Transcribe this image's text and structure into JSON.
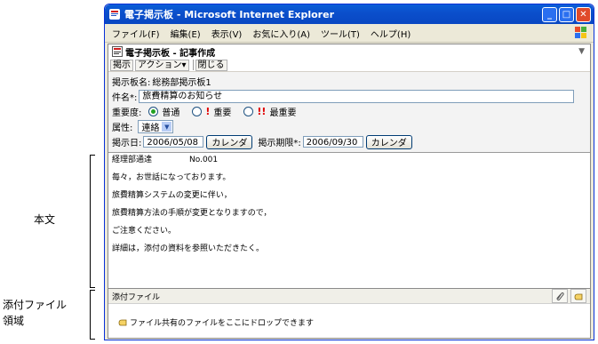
{
  "annotations": {
    "body_label": "本文",
    "attach_label": "添付ファイル\n領域"
  },
  "window": {
    "title": "電子掲示板 - Microsoft Internet Explorer",
    "buttons": {
      "minimize": "_",
      "maximize": "□",
      "close": "✕"
    }
  },
  "menu": [
    "ファイル(F)",
    "編集(E)",
    "表示(V)",
    "お気に入り(A)",
    "ツール(T)",
    "ヘルプ(H)"
  ],
  "page": {
    "title": "電子掲示板 - 記事作成",
    "collapse_glyph": "▼"
  },
  "toolbar": {
    "post": "掲示",
    "action": "アクション▾",
    "close": "閉じる"
  },
  "form": {
    "board_label": "掲示板名:",
    "board_value": "総務部掲示板1",
    "subject_label": "件名*:",
    "subject_value": "旅費精算のお知らせ",
    "priority_label": "重要度:",
    "priority_options": [
      "普通",
      "重要",
      "最重要"
    ],
    "priority_selected": "普通",
    "attr_label": "属性:",
    "attr_value": "連絡",
    "post_date_label": "掲示日:",
    "post_date_value": "2006/05/08",
    "calendar_label": "カレンダ",
    "deadline_label": "掲示期限*:",
    "deadline_value": "2006/09/30"
  },
  "body_lines": [
    "経理部通達",
    "No.001",
    "毎々，お世話になっております。",
    "旅費精算システムの変更に伴い，",
    "旅費精算方法の手順が変更となりますので，",
    "ご注意ください。",
    "詳細は，添付の資料を参照いただきたく。"
  ],
  "attachments": {
    "header": "添付ファイル",
    "drop_hint": "ファイル共有のファイルをここにドロップできます"
  },
  "colors": {
    "titlebar": "#0a5fd8",
    "accent_red": "#e00000",
    "radio_green": "#21a121"
  }
}
